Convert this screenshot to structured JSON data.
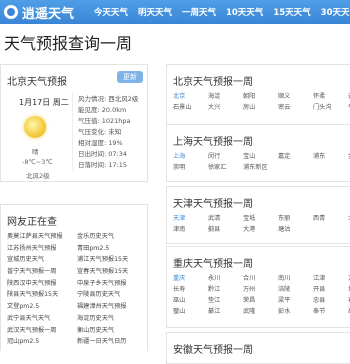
{
  "site": {
    "name": "逍遥天气"
  },
  "nav": [
    "今天天气",
    "明天天气",
    "一周天气",
    "10天天气",
    "15天天气",
    "30天天气"
  ],
  "page_title": "天气预报查询一周",
  "weather_card": {
    "title": "北京天气预报",
    "update_label": "更新",
    "date": "1月17日 周二",
    "condition": "晴",
    "temp_range": "-8℃~3℃",
    "wind_short": "北风2级",
    "details": [
      "风力情况: 西北风2级",
      "能见度: 20.0km",
      "气压值: 1021hpa",
      "气压变化: 未知",
      "相对湿度: 19%",
      "日出时间: 07:34",
      "日落时间: 17:15"
    ]
  },
  "friends": {
    "title": "网友正在查",
    "rows": [
      [
        "奥莫江萨县天气预报",
        "金乐历史天气"
      ],
      [
        "江苏扬州天气预报",
        "青田pm2.5"
      ],
      [
        "宣城历史天气",
        "浦江天气预报15天"
      ],
      [
        "普宁天气预报一周",
        "宣春天气预报15天"
      ],
      [
        "陕西汉中天气预报",
        "中泉子乡天气预报"
      ],
      [
        "陕县天气预报15天",
        "宁陵县历史天气"
      ],
      [
        "文登pm2.5",
        "福建漳州天气预报"
      ],
      [
        "武宁县天气天气",
        "海淀历史天气"
      ],
      [
        "武汉天气预报一周",
        "衡山历史天气"
      ],
      [
        "冠山pm2.5",
        "新疆一日天气日历"
      ]
    ]
  },
  "cities": [
    {
      "title": "北京天气预报一周",
      "rows": [
        [
          "北京",
          "海淀",
          "朝阳",
          "顺义",
          "怀柔",
          "通州"
        ],
        [
          "石景山",
          "大兴",
          "房山",
          "密云",
          "门头沟",
          "平谷"
        ]
      ]
    },
    {
      "title": "上海天气预报一周",
      "rows": [
        [
          "上海",
          "闵行",
          "宝山",
          "嘉定",
          "浦东",
          "金山"
        ],
        [
          "崇明",
          "徐家汇",
          "浦东新区",
          "",
          "",
          ""
        ]
      ]
    },
    {
      "title": "天津天气预报一周",
      "rows": [
        [
          "天津",
          "武清",
          "宝坻",
          "东丽",
          "西青",
          "北辰"
        ],
        [
          "津南",
          "蓟县",
          "大港",
          "塘沽",
          "",
          ""
        ]
      ]
    },
    {
      "title": "重庆天气预报一周",
      "rows": [
        [
          "重庆",
          "永川",
          "合川",
          "南川",
          "江津",
          "万盛"
        ],
        [
          "长寿",
          "黔江",
          "万州",
          "涪陵",
          "开县",
          "城口"
        ],
        [
          "巫山",
          "垫江",
          "荣昌",
          "梁平",
          "忠县",
          "石柱"
        ],
        [
          "璧山",
          "綦江",
          "武隆",
          "彭水",
          "奉节",
          "巫溪"
        ]
      ]
    },
    {
      "title": "安徽天气预报一周",
      "rows": []
    }
  ]
}
